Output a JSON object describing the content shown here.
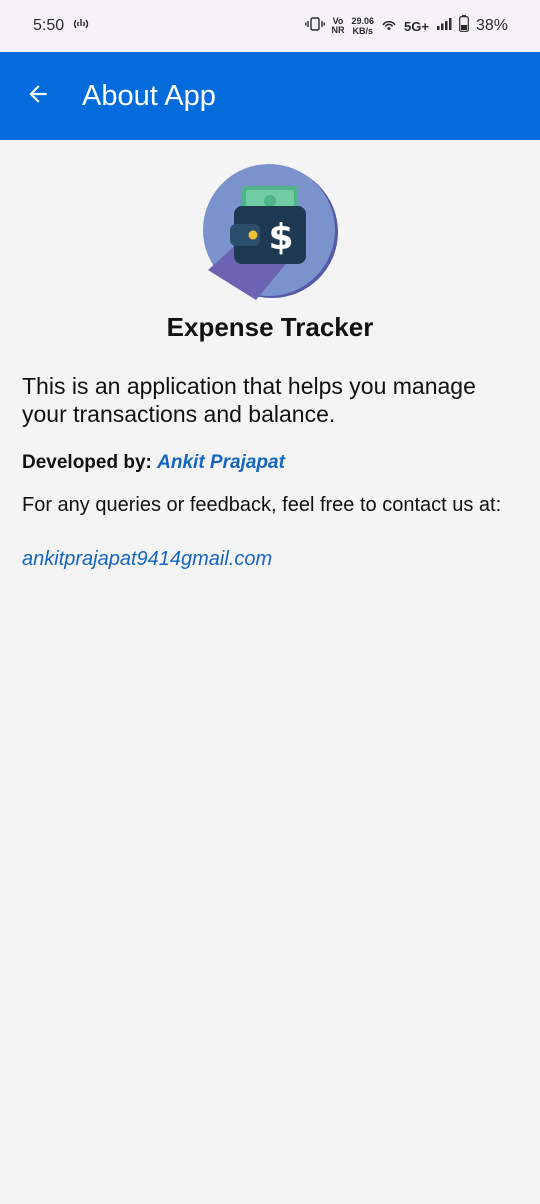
{
  "status_bar": {
    "time": "5:50",
    "volte_label_top": "Vo",
    "volte_label_bottom": "NR",
    "net_speed_value": "29.06",
    "net_speed_unit": "KB/s",
    "network_type": "5G+",
    "battery_percent": "38%"
  },
  "app_bar": {
    "title": "About App",
    "background_color": "#036bdc",
    "back_icon": "arrow-left-icon"
  },
  "about": {
    "app_name": "Expense Tracker",
    "description": "This is an application that helps you manage your transactions and balance.",
    "developed_by_label": "Developed by:",
    "developer_name": "Ankit Prajapat",
    "contact_text": "For any queries or feedback, feel free to contact us at:",
    "email": "ankitprajapat9414gmail.com",
    "link_color": "#1565c0",
    "logo_icon": "wallet-dollar-icon"
  }
}
